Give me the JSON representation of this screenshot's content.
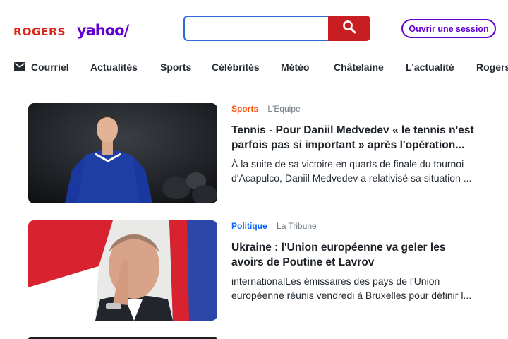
{
  "header": {
    "logo_rogers": "ROGERS",
    "logo_yahoo": "yahoo/",
    "search_placeholder": "",
    "signin_label": "Ouvrir une session"
  },
  "nav": {
    "items": [
      {
        "label": "Courriel",
        "icon": "mail-icon"
      },
      {
        "label": "Actualités"
      },
      {
        "label": "Sports"
      },
      {
        "label": "Célébrités"
      },
      {
        "label": "Météo"
      },
      {
        "label": "Châtelaine"
      },
      {
        "label": "L'actualité"
      },
      {
        "label": "Rogers"
      }
    ]
  },
  "articles": [
    {
      "category": "Sports",
      "category_color": "#ff520d",
      "source": "L'Equipe",
      "title": "Tennis - Pour Daniil Medvedev « le tennis n'est parfois pas si important » après l'opération...",
      "summary": "À la suite de sa victoire en quarts de finale du tournoi d'Acapulco, Daniil Medvedev a relativisé sa situation ..."
    },
    {
      "category": "Politique",
      "category_color": "#0f69ff",
      "source": "La Tribune",
      "title": "Ukraine : l'Union européenne va geler les avoirs de Poutine et Lavrov",
      "summary": "internationalLes émissaires des pays de l'Union européenne réunis vendredi à Bruxelles pour définir l..."
    }
  ],
  "colors": {
    "brand_purple": "#6001d2",
    "rogers_red": "#da291c",
    "search_button": "#c81e22"
  }
}
